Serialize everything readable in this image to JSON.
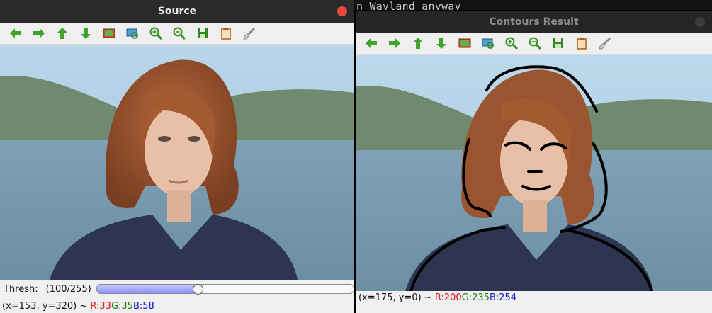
{
  "background_terminal": {
    "text": "n Wayland anyway"
  },
  "source_window": {
    "title": "Source",
    "trackbar": {
      "label": "Thresh:",
      "value_text": "(100/255)",
      "value": 100,
      "max": 255
    },
    "status": {
      "coords": "(x=153, y=320) ~ ",
      "r": "R:33",
      "g": "G:35",
      "b": "B:58"
    }
  },
  "result_window": {
    "title": "Contours Result",
    "status": {
      "coords": "(x=175, y=0) ~ ",
      "r": "R:200",
      "g": "G:235",
      "b": "B:254"
    }
  },
  "toolbar_icons": [
    "arrow-left-icon",
    "arrow-right-icon",
    "arrow-up-icon",
    "arrow-down-icon",
    "image-icon",
    "image-zoom-icon",
    "zoom-in-icon",
    "zoom-out-icon",
    "save-icon",
    "clipboard-icon",
    "brush-icon"
  ],
  "colors": {
    "close_active": "#e8483f",
    "icon_green": "#3fa32c",
    "slider_fill": "#8b8ef5"
  }
}
